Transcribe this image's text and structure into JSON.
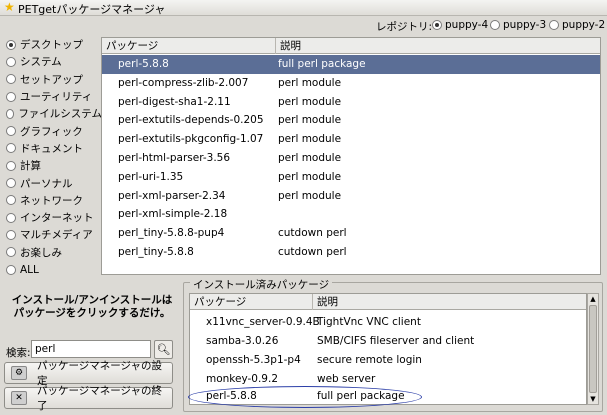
{
  "window": {
    "title": "PETgetパッケージマネージャ"
  },
  "repo": {
    "label": "レポジトリ:",
    "options": [
      {
        "label": "puppy-4",
        "selected": true
      },
      {
        "label": "puppy-3",
        "selected": false
      },
      {
        "label": "puppy-2",
        "selected": false
      }
    ]
  },
  "categories": [
    {
      "label": "デスクトップ",
      "selected": true
    },
    {
      "label": "システム",
      "selected": false
    },
    {
      "label": "セットアップ",
      "selected": false
    },
    {
      "label": "ユーティリティ",
      "selected": false
    },
    {
      "label": "ファイルシステム",
      "selected": false
    },
    {
      "label": "グラフィック",
      "selected": false
    },
    {
      "label": "ドキュメント",
      "selected": false
    },
    {
      "label": "計算",
      "selected": false
    },
    {
      "label": "パーソナル",
      "selected": false
    },
    {
      "label": "ネットワーク",
      "selected": false
    },
    {
      "label": "インターネット",
      "selected": false
    },
    {
      "label": "マルチメディア",
      "selected": false
    },
    {
      "label": "お楽しみ",
      "selected": false
    },
    {
      "label": "ALL",
      "selected": false
    }
  ],
  "package_table": {
    "headers": [
      "パッケージ",
      "説明"
    ],
    "rows": [
      {
        "name": "perl-5.8.8",
        "desc": "full perl package",
        "selected": true
      },
      {
        "name": "perl-compress-zlib-2.007",
        "desc": "perl module",
        "selected": false
      },
      {
        "name": "perl-digest-sha1-2.11",
        "desc": "perl module",
        "selected": false
      },
      {
        "name": "perl-extutils-depends-0.205",
        "desc": "perl module",
        "selected": false
      },
      {
        "name": "perl-extutils-pkgconfig-1.07",
        "desc": "perl module",
        "selected": false
      },
      {
        "name": "perl-html-parser-3.56",
        "desc": "perl module",
        "selected": false
      },
      {
        "name": "perl-uri-1.35",
        "desc": "perl module",
        "selected": false
      },
      {
        "name": "perl-xml-parser-2.34",
        "desc": "perl module",
        "selected": false
      },
      {
        "name": "perl-xml-simple-2.18",
        "desc": "",
        "selected": false
      },
      {
        "name": "perl_tiny-5.8.8-pup4",
        "desc": "cutdown perl",
        "selected": false
      },
      {
        "name": "perl_tiny-5.8.8",
        "desc": "cutdown perl",
        "selected": false
      }
    ]
  },
  "help": {
    "line1": "インストール/アンインストールは",
    "line2": "パッケージをクリックするだけ。"
  },
  "search": {
    "label": "検索:",
    "value": "perl",
    "button_icon": "search-icon"
  },
  "buttons": {
    "settings": "パッケージマネージャの設定",
    "quit": "パッケージマネージャの終了"
  },
  "installed": {
    "title": "インストール済みパッケージ",
    "headers": [
      "パッケージ",
      "説明"
    ],
    "rows": [
      {
        "name": "x11vnc_server-0.9.4B",
        "desc": "TightVnc VNC client"
      },
      {
        "name": "samba-3.0.26",
        "desc": "SMB/CIFS fileserver and client"
      },
      {
        "name": "openssh-5.3p1-p4",
        "desc": "secure remote login"
      },
      {
        "name": "monkey-0.9.2",
        "desc": "web server"
      },
      {
        "name": "perl-5.8.8",
        "desc": "full perl package"
      }
    ]
  },
  "colors": {
    "selection": "#5b6e96",
    "annotation": "#2c3fa8"
  }
}
